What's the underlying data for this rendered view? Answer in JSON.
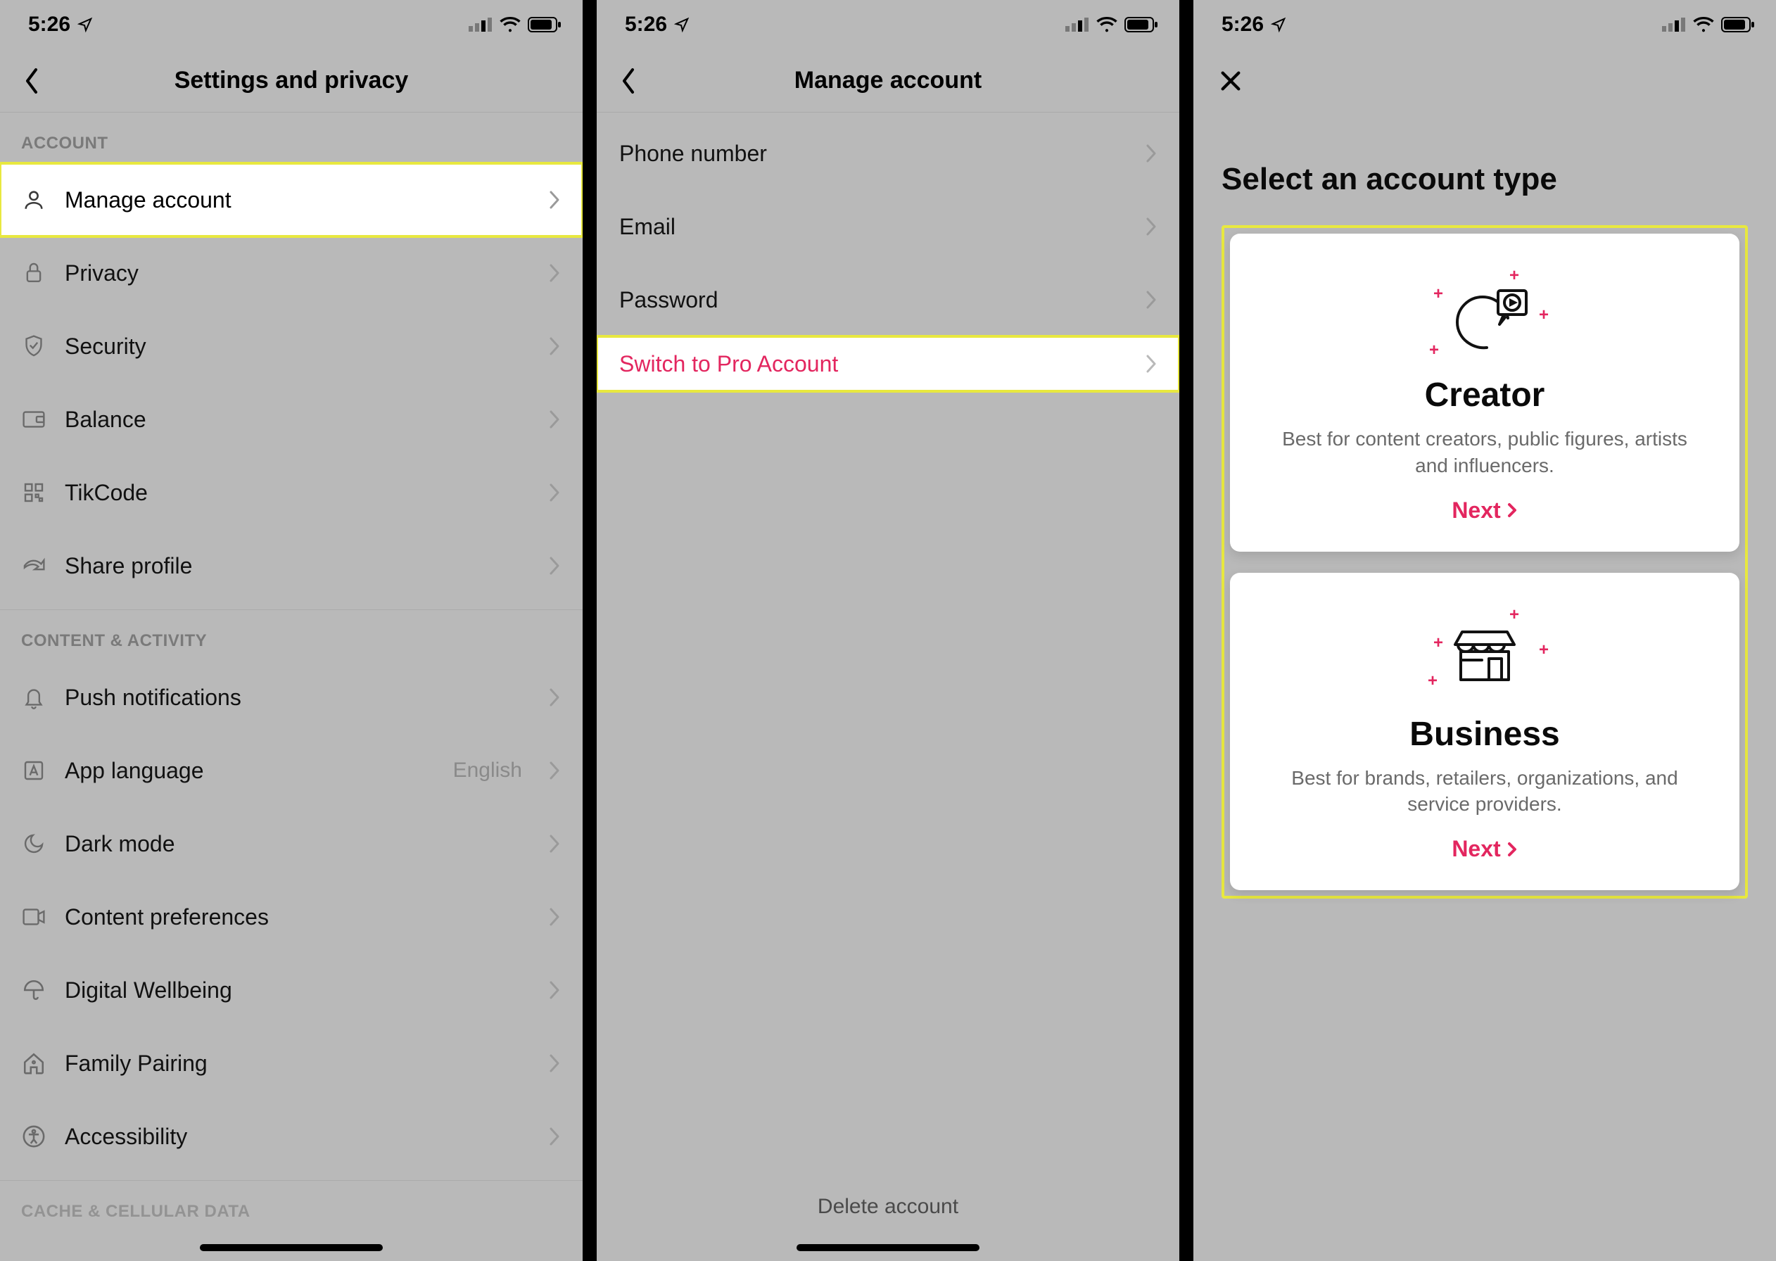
{
  "status": {
    "time": "5:26"
  },
  "screen1": {
    "title": "Settings and privacy",
    "sections": {
      "account": {
        "header": "ACCOUNT",
        "items": [
          {
            "label": "Manage account"
          },
          {
            "label": "Privacy"
          },
          {
            "label": "Security"
          },
          {
            "label": "Balance"
          },
          {
            "label": "TikCode"
          },
          {
            "label": "Share profile"
          }
        ]
      },
      "content": {
        "header": "CONTENT & ACTIVITY",
        "items": [
          {
            "label": "Push notifications"
          },
          {
            "label": "App language",
            "value": "English"
          },
          {
            "label": "Dark mode"
          },
          {
            "label": "Content preferences"
          },
          {
            "label": "Digital Wellbeing"
          },
          {
            "label": "Family Pairing"
          },
          {
            "label": "Accessibility"
          }
        ]
      },
      "cache": {
        "header": "CACHE & CELLULAR DATA"
      }
    }
  },
  "screen2": {
    "title": "Manage account",
    "items": [
      {
        "label": "Phone number"
      },
      {
        "label": "Email"
      },
      {
        "label": "Password"
      },
      {
        "label": "Switch to Pro Account"
      }
    ],
    "delete_label": "Delete account"
  },
  "screen3": {
    "title": "Select an account type",
    "cards": [
      {
        "title": "Creator",
        "subtitle": "Best for content creators, public figures, artists and influencers.",
        "cta": "Next"
      },
      {
        "title": "Business",
        "subtitle": "Best for brands, retailers, organizations, and service providers.",
        "cta": "Next"
      }
    ]
  }
}
